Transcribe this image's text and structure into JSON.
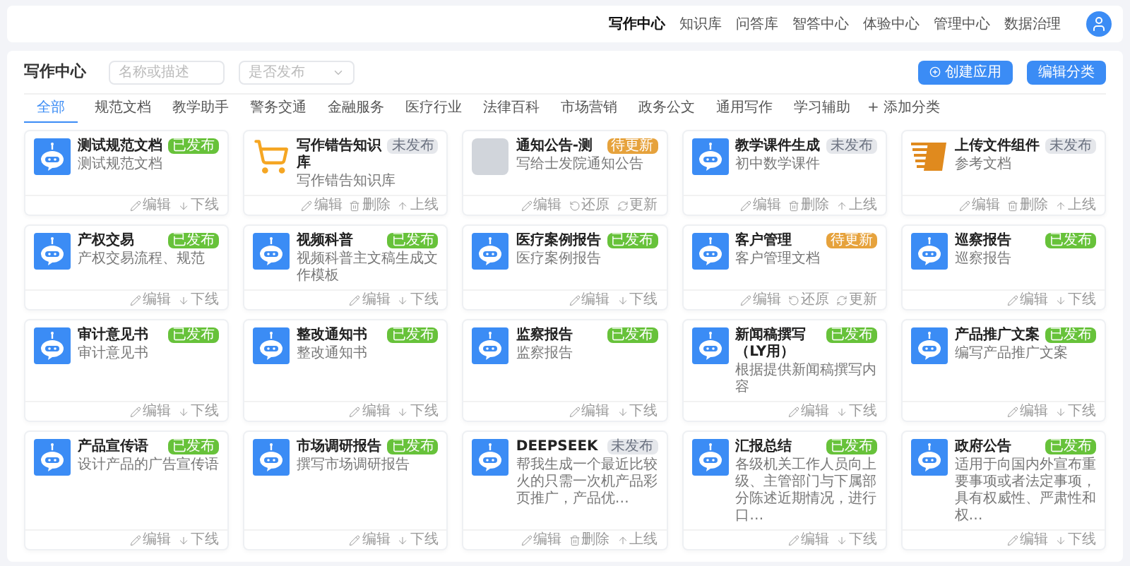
{
  "nav": {
    "items": [
      {
        "label": "写作中心",
        "selected": true
      },
      {
        "label": "知识库",
        "selected": false
      },
      {
        "label": "问答库",
        "selected": false
      },
      {
        "label": "智答中心",
        "selected": false
      },
      {
        "label": "体验中心",
        "selected": false
      },
      {
        "label": "管理中心",
        "selected": false
      },
      {
        "label": "数据治理",
        "selected": false
      }
    ]
  },
  "toolbar": {
    "title": "写作中心",
    "search": {
      "placeholder": "名称或描述"
    },
    "status_select": {
      "placeholder": "是否发布"
    },
    "buttons": [
      {
        "label": "创建应用",
        "kind": "create"
      },
      {
        "label": "编辑分类",
        "kind": "plain"
      }
    ]
  },
  "categories": [
    {
      "label": "全部",
      "selected": true
    },
    {
      "label": "规范文档",
      "selected": false
    },
    {
      "label": "教学助手",
      "selected": false
    },
    {
      "label": "警务交通",
      "selected": false
    },
    {
      "label": "金融服务",
      "selected": false
    },
    {
      "label": "医疗行业",
      "selected": false
    },
    {
      "label": "法律百科",
      "selected": false
    },
    {
      "label": "市场营销",
      "selected": false
    },
    {
      "label": "政务公文",
      "selected": false
    },
    {
      "label": "通用写作",
      "selected": false
    },
    {
      "label": "学习辅助",
      "selected": false
    }
  ],
  "add_category": "+ 添加分类",
  "apps": [
    {
      "title": "测试规范文档",
      "description": "测试规范文档",
      "kind": "robot",
      "status": "已发布",
      "color": "#67c23a",
      "actions": [
        {
          "label": "编辑",
          "kind": "edit"
        },
        {
          "label": "下线",
          "kind": "down"
        }
      ]
    },
    {
      "title": "写作错告知识库",
      "description": "写作错告知识库",
      "kind": "cart",
      "status": "未发布",
      "color": "#e5e7eb",
      "actions": [
        {
          "label": "编辑",
          "kind": "edit"
        },
        {
          "label": "删除",
          "kind": "delete"
        },
        {
          "label": "上线",
          "kind": "up"
        }
      ]
    },
    {
      "title": "通知公告-测",
      "description": "写给士发院通知公告",
      "kind": "photo",
      "status": "待更新",
      "color": "#e6a23c",
      "actions": [
        {
          "label": "编辑",
          "kind": "edit"
        },
        {
          "label": "还原",
          "kind": "restore"
        },
        {
          "label": "更新",
          "kind": "update"
        }
      ]
    },
    {
      "title": "教学课件生成",
      "description": "初中数学课件",
      "kind": "robot",
      "status": "未发布",
      "color": "#e5e7eb",
      "actions": [
        {
          "label": "编辑",
          "kind": "edit"
        },
        {
          "label": "删除",
          "kind": "delete"
        },
        {
          "label": "上线",
          "kind": "up"
        }
      ]
    },
    {
      "title": "上传文件组件",
      "description": "参考文档",
      "kind": "logo",
      "status": "未发布",
      "color": "#e5e7eb",
      "actions": [
        {
          "label": "编辑",
          "kind": "edit"
        },
        {
          "label": "删除",
          "kind": "delete"
        },
        {
          "label": "上线",
          "kind": "up"
        }
      ]
    },
    {
      "title": "产权交易",
      "description": "产权交易流程、规范",
      "kind": "robot",
      "status": "已发布",
      "color": "#67c23a",
      "actions": [
        {
          "label": "编辑",
          "kind": "edit"
        },
        {
          "label": "下线",
          "kind": "down"
        }
      ]
    },
    {
      "title": "视频科普",
      "description": "视频科普主文稿生成文作模板",
      "kind": "robot",
      "status": "已发布",
      "color": "#67c23a",
      "actions": [
        {
          "label": "编辑",
          "kind": "edit"
        },
        {
          "label": "下线",
          "kind": "down"
        }
      ]
    },
    {
      "title": "医疗案例报告",
      "description": "医疗案例报告",
      "kind": "robot",
      "status": "已发布",
      "color": "#67c23a",
      "actions": [
        {
          "label": "编辑",
          "kind": "edit"
        },
        {
          "label": "下线",
          "kind": "down"
        }
      ]
    },
    {
      "title": "客户管理",
      "description": "客户管理文档",
      "kind": "robot",
      "status": "待更新",
      "color": "#e6a23c",
      "actions": [
        {
          "label": "编辑",
          "kind": "edit"
        },
        {
          "label": "还原",
          "kind": "restore"
        },
        {
          "label": "更新",
          "kind": "update"
        }
      ]
    },
    {
      "title": "巡察报告",
      "description": "巡察报告",
      "kind": "robot",
      "status": "已发布",
      "color": "#67c23a",
      "actions": [
        {
          "label": "编辑",
          "kind": "edit"
        },
        {
          "label": "下线",
          "kind": "down"
        }
      ]
    },
    {
      "title": "审计意见书",
      "description": "审计意见书",
      "kind": "robot",
      "status": "已发布",
      "color": "#67c23a",
      "actions": [
        {
          "label": "编辑",
          "kind": "edit"
        },
        {
          "label": "下线",
          "kind": "down"
        }
      ]
    },
    {
      "title": "整改通知书",
      "description": "整改通知书",
      "kind": "robot",
      "status": "已发布",
      "color": "#67c23a",
      "actions": [
        {
          "label": "编辑",
          "kind": "edit"
        },
        {
          "label": "下线",
          "kind": "down"
        }
      ]
    },
    {
      "title": "监察报告",
      "description": "监察报告",
      "kind": "robot",
      "status": "已发布",
      "color": "#67c23a",
      "actions": [
        {
          "label": "编辑",
          "kind": "edit"
        },
        {
          "label": "下线",
          "kind": "down"
        }
      ]
    },
    {
      "title": "新闻稿撰写（LY用）",
      "description": "根据提供新闻稿撰写内容",
      "kind": "robot",
      "status": "已发布",
      "color": "#67c23a",
      "actions": [
        {
          "label": "编辑",
          "kind": "edit"
        },
        {
          "label": "下线",
          "kind": "down"
        }
      ]
    },
    {
      "title": "产品推广文案",
      "description": "编写产品推广文案",
      "kind": "robot",
      "status": "已发布",
      "color": "#67c23a",
      "actions": [
        {
          "label": "编辑",
          "kind": "edit"
        },
        {
          "label": "下线",
          "kind": "down"
        }
      ]
    },
    {
      "title": "产品宣传语",
      "description": "设计产品的广告宣传语",
      "kind": "robot",
      "status": "已发布",
      "color": "#67c23a",
      "actions": [
        {
          "label": "编辑",
          "kind": "edit"
        },
        {
          "label": "下线",
          "kind": "down"
        }
      ]
    },
    {
      "title": "市场调研报告",
      "description": "撰写市场调研报告",
      "kind": "robot",
      "status": "已发布",
      "color": "#67c23a",
      "actions": [
        {
          "label": "编辑",
          "kind": "edit"
        },
        {
          "label": "下线",
          "kind": "down"
        }
      ]
    },
    {
      "title": "DEEPSEEK",
      "description": "帮我生成一个最近比较火的只需一次机产品彩页推广，产品优…",
      "kind": "robot",
      "status": "未发布",
      "color": "#e5e7eb",
      "actions": [
        {
          "label": "编辑",
          "kind": "edit"
        },
        {
          "label": "删除",
          "kind": "delete"
        },
        {
          "label": "上线",
          "kind": "up"
        }
      ]
    },
    {
      "title": "汇报总结",
      "description": "各级机关工作人员向上级、主管部门与下属部分陈述近期情况，进行口…",
      "kind": "robot",
      "status": "已发布",
      "color": "#67c23a",
      "actions": [
        {
          "label": "编辑",
          "kind": "edit"
        },
        {
          "label": "下线",
          "kind": "down"
        }
      ]
    },
    {
      "title": "政府公告",
      "description": "适用于向国内外宣布重要事项或者法定事项，具有权威性、严肃性和权…",
      "kind": "robot",
      "status": "已发布",
      "color": "#67c23a",
      "actions": [
        {
          "label": "编辑",
          "kind": "edit"
        },
        {
          "label": "下线",
          "kind": "down"
        }
      ]
    }
  ]
}
